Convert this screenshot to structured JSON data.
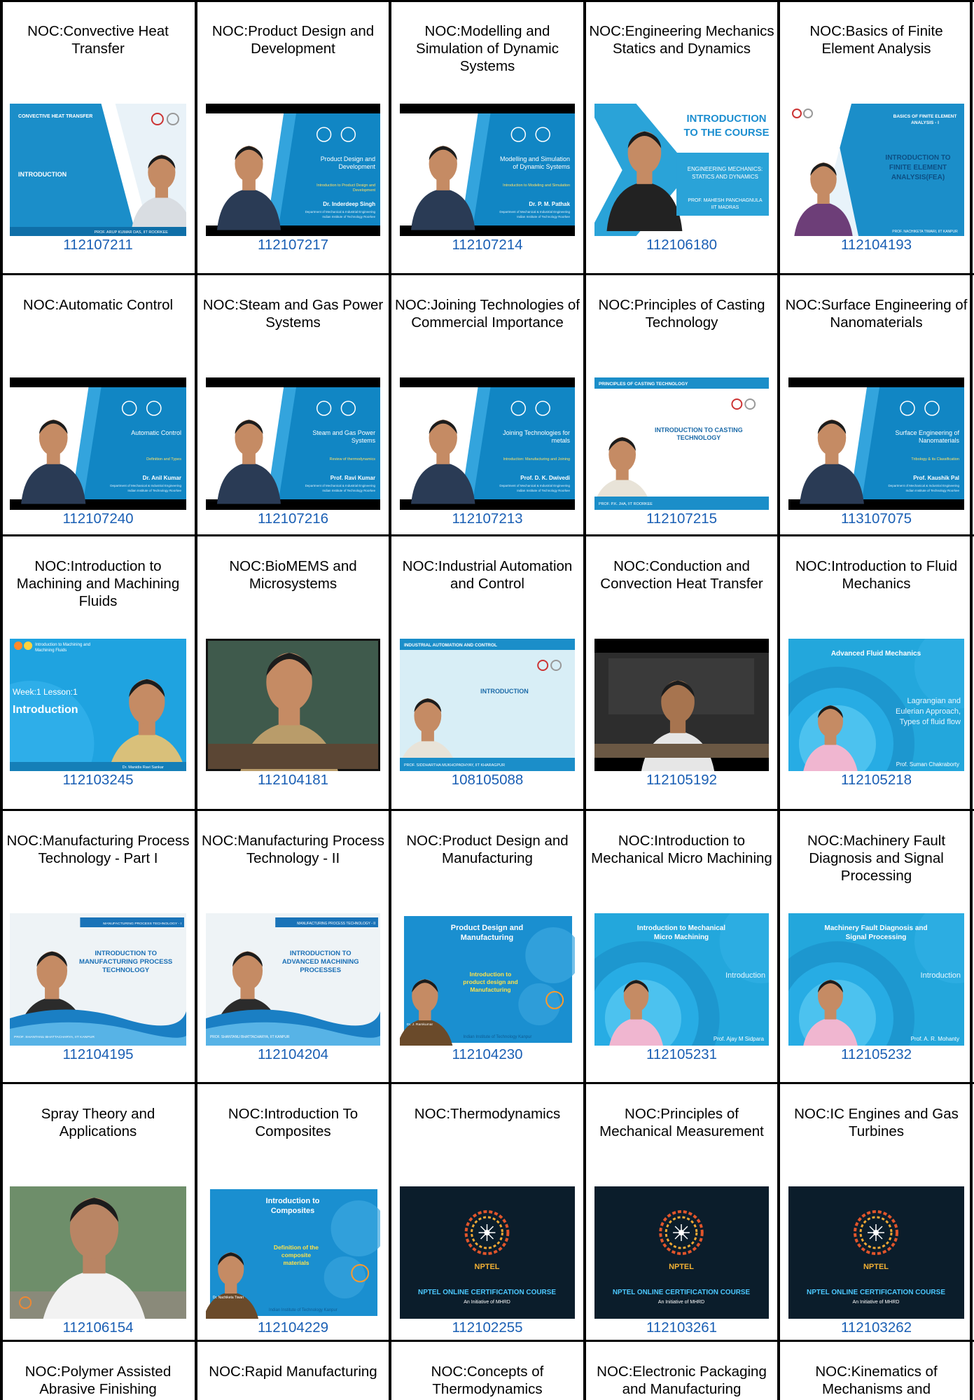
{
  "rows": [
    [
      {
        "title": "NOC:Convective Heat Transfer",
        "code": "112107211",
        "thumb": {
          "style": "slide-right",
          "heading": "CONVECTIVE HEAT TRANSFER",
          "main": "INTRODUCTION",
          "footer": "PROF. ARUP KUMAR DAS, IIT ROORKEE",
          "bg": "#1b8ec9"
        }
      },
      {
        "title": "NOC:Product Design and Development",
        "code": "112107217",
        "thumb": {
          "style": "slide-left",
          "main": "Product Design and Development",
          "sub": "Introduction to Product Design and Development",
          "name": "Dr. Inderdeep Singh",
          "bg": "#1186c4"
        }
      },
      {
        "title": "NOC:Modelling and Simulation of Dynamic Systems",
        "code": "112107214",
        "thumb": {
          "style": "slide-left",
          "main": "Modelling and Simulation of Dynamic Systems",
          "sub": "Introduction to Modeling and Simulation",
          "name": "Dr. P. M. Pathak",
          "bg": "#1186c4"
        }
      },
      {
        "title": "NOC:Engineering Mechanics Statics and Dynamics",
        "code": "112106180",
        "thumb": {
          "style": "white-intro",
          "main": "INTRODUCTION TO THE COURSE",
          "sub": "ENGINEERING MECHANICS: STATICS AND DYNAMICS",
          "name": "PROF. MAHESH PANCHAGNULA IIT MADRAS",
          "bg": "#ffffff"
        }
      },
      {
        "title": "NOC:Basics of Finite Element Analysis",
        "code": "112104193",
        "thumb": {
          "style": "slide-right-light",
          "heading": "BASICS OF FINITE ELEMENT ANALYSIS - I",
          "main": "INTRODUCTION TO FINITE ELEMENT ANALYSIS(FEA)",
          "footer": "PROF. NACHIKETA TIWARI, IIT KANPUR",
          "bg": "#1b8ec9"
        }
      }
    ],
    [
      {
        "title": "NOC:Automatic Control",
        "code": "112107240",
        "thumb": {
          "style": "slide-left",
          "main": "Automatic Control",
          "sub": "Definition and Types",
          "name": "Dr. Anil Kumar",
          "bg": "#1186c4"
        }
      },
      {
        "title": "NOC:Steam and Gas Power Systems",
        "code": "112107216",
        "thumb": {
          "style": "slide-left",
          "main": "Steam and Gas Power Systems",
          "sub": "Review of thermodynamics",
          "name": "Prof. Ravi Kumar",
          "bg": "#1186c4"
        }
      },
      {
        "title": "NOC:Joining Technologies of Commercial Importance",
        "code": "112107213",
        "thumb": {
          "style": "slide-left",
          "main": "Joining Technologies for metals",
          "sub": "Introduction: Manufacturing and Joining",
          "name": "Prof. D. K. Dwivedi",
          "bg": "#1186c4"
        }
      },
      {
        "title": "NOC:Principles of Casting Technology",
        "code": "112107215",
        "thumb": {
          "style": "white-band",
          "heading": "PRINCIPLES OF CASTING TECHNOLOGY",
          "main": "INTRODUCTION TO CASTING TECHNOLOGY",
          "footer": "PROF. P.K. JHA, IIT ROORKEE",
          "bg": "#ffffff"
        }
      },
      {
        "title": "NOC:Surface Engineering of Nanomaterials",
        "code": "113107075",
        "thumb": {
          "style": "slide-left",
          "main": "Surface Engineering of Nanomaterials",
          "sub": "Tribology & its Classification",
          "name": "Prof. Kaushik Pal",
          "bg": "#1186c4"
        }
      }
    ],
    [
      {
        "title": "NOC:Introduction to Machining and Machining Fluids",
        "code": "112103245",
        "thumb": {
          "style": "bright-blue",
          "heading": "Introduction to Machining and Machining Fluids",
          "main": "Week:1 Lesson:1 Introduction",
          "footer": "Dr. Manidis Ravi Sankar",
          "bg": "#1fa3e0"
        }
      },
      {
        "title": "NOC:BioMEMS and Microsystems",
        "code": "112104181",
        "thumb": {
          "style": "board",
          "bg": "#3f5a4c"
        }
      },
      {
        "title": "NOC:Industrial Automation and Control",
        "code": "108105088",
        "thumb": {
          "style": "white-band",
          "heading": "INDUSTRIAL AUTOMATION AND CONTROL",
          "main": "INTRODUCTION",
          "footer": "PROF. SIDDHARTHA MUKHOPADHYAY, IIT KHARAGPUR",
          "bg": "#d8eef6"
        }
      },
      {
        "title": "NOC:Conduction and Convection Heat Transfer",
        "code": "112105192",
        "thumb": {
          "style": "lecture",
          "bg": "#2d2d2d"
        }
      },
      {
        "title": "NOC:Introduction to Fluid Mechanics",
        "code": "112105218",
        "thumb": {
          "style": "circles",
          "heading": "Advanced Fluid Mechanics",
          "main": "Lagrangian and Eulerian Approach, Types of fluid flow",
          "footer": "Prof. Suman Chakraborty",
          "bg": "#23a7dc"
        }
      }
    ],
    [
      {
        "title": "NOC:Manufacturing Process Technology - Part I",
        "code": "112104195",
        "thumb": {
          "style": "wave",
          "heading": "MANUFACTURING PROCESS TECHNOLOGY - I",
          "main": "INTRODUCTION TO MANUFACTURING PROCESS TECHNOLOGY",
          "footer": "PROF. SHANTANU BHATTACHARYA, IIT KANPUR",
          "bg": "#eef3f6"
        }
      },
      {
        "title": "NOC:Manufacturing Process Technology - II",
        "code": "112104204",
        "thumb": {
          "style": "wave",
          "heading": "MANUFACTURING PROCESS TECHNOLOGY - II",
          "main": "INTRODUCTION TO ADVANCED MACHINING PROCESSES",
          "footer": "PROF. SHANTANU BHATTACHARYA, IIT KANPUR",
          "bg": "#eef3f6"
        }
      },
      {
        "title": "NOC:Product Design and Manufacturing",
        "code": "112104230",
        "thumb": {
          "style": "bubbles",
          "main": "Product Design and Manufacturing",
          "sub": "Introduction to product design and Manufacturing",
          "footer": "Indian Institute of Technology Kanpur",
          "name": "Dr. J. Ramkumar",
          "bg": "#1a8fd0"
        }
      },
      {
        "title": "NOC:Introduction to Mechanical Micro Machining",
        "code": "112105231",
        "thumb": {
          "style": "circles",
          "heading": "Introduction to Mechanical Micro Machining",
          "main": "Introduction",
          "footer": "Prof. Ajay M Sidpara",
          "bg": "#23a7dc"
        }
      },
      {
        "title": "NOC:Machinery Fault Diagnosis and Signal Processing",
        "code": "112105232",
        "thumb": {
          "style": "circles",
          "heading": "Machinery Fault Diagnosis and Signal Processing",
          "main": "Introduction",
          "footer": "Prof. A. R. Mohanty",
          "bg": "#23a7dc"
        }
      }
    ],
    [
      {
        "title": "Spray Theory and Applications",
        "code": "112106154",
        "thumb": {
          "style": "speaker",
          "bg": "#6e8e6a"
        }
      },
      {
        "title": "NOC:Introduction To Composites",
        "code": "112104229",
        "thumb": {
          "style": "bubbles",
          "main": "Introduction to Composites",
          "sub": "Definition of the composite materials",
          "footer": "Indian Institute of Technology Kanpur",
          "name": "Dr. Nachiketa Tiwari",
          "bg": "#1a8fd0"
        }
      },
      {
        "title": "NOC:Thermodynamics",
        "code": "112102255",
        "thumb": {
          "style": "nptel",
          "main": "NPTEL",
          "sub": "NPTEL ONLINE CERTIFICATION COURSE",
          "footer": "An Initiative of MHRD",
          "bg": "#0b1d2b"
        }
      },
      {
        "title": "NOC:Principles of Mechanical Measurement",
        "code": "112103261",
        "thumb": {
          "style": "nptel",
          "main": "NPTEL",
          "sub": "NPTEL ONLINE CERTIFICATION COURSE",
          "footer": "An Initiative of MHRD",
          "bg": "#0b1d2b"
        }
      },
      {
        "title": "NOC:IC Engines and Gas Turbines",
        "code": "112103262",
        "thumb": {
          "style": "nptel",
          "main": "NPTEL",
          "sub": "NPTEL ONLINE CERTIFICATION COURSE",
          "footer": "An Initiative of MHRD",
          "bg": "#0b1d2b"
        }
      }
    ],
    [
      {
        "title": "NOC:Polymer Assisted Abrasive Finishing",
        "code": "",
        "thumb": null
      },
      {
        "title": "NOC:Rapid Manufacturing",
        "code": "",
        "thumb": null
      },
      {
        "title": "NOC:Concepts of Thermodynamics",
        "code": "",
        "thumb": null
      },
      {
        "title": "NOC:Electronic Packaging and Manufacturing",
        "code": "",
        "thumb": null
      },
      {
        "title": "NOC:Kinematics of Mechanisms and",
        "code": "",
        "thumb": null
      }
    ]
  ]
}
